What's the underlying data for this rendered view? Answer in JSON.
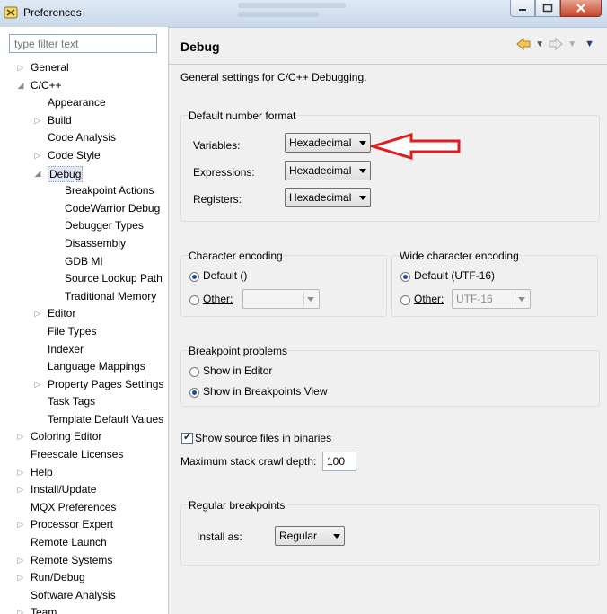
{
  "window": {
    "title": "Preferences"
  },
  "filter": {
    "placeholder": "type filter text"
  },
  "tree": [
    {
      "label": "General",
      "indent": 0,
      "arrow": "closed"
    },
    {
      "label": "C/C++",
      "indent": 0,
      "arrow": "open"
    },
    {
      "label": "Appearance",
      "indent": 1,
      "arrow": "none"
    },
    {
      "label": "Build",
      "indent": 1,
      "arrow": "closed"
    },
    {
      "label": "Code Analysis",
      "indent": 1,
      "arrow": "none"
    },
    {
      "label": "Code Style",
      "indent": 1,
      "arrow": "closed"
    },
    {
      "label": "Debug",
      "indent": 1,
      "arrow": "open",
      "selected": true
    },
    {
      "label": "Breakpoint Actions",
      "indent": 2,
      "arrow": "none"
    },
    {
      "label": "CodeWarrior Debug",
      "indent": 2,
      "arrow": "none"
    },
    {
      "label": "Debugger Types",
      "indent": 2,
      "arrow": "none"
    },
    {
      "label": "Disassembly",
      "indent": 2,
      "arrow": "none"
    },
    {
      "label": "GDB MI",
      "indent": 2,
      "arrow": "none"
    },
    {
      "label": "Source Lookup Path",
      "indent": 2,
      "arrow": "none"
    },
    {
      "label": "Traditional Memory",
      "indent": 2,
      "arrow": "none"
    },
    {
      "label": "Editor",
      "indent": 1,
      "arrow": "closed"
    },
    {
      "label": "File Types",
      "indent": 1,
      "arrow": "none"
    },
    {
      "label": "Indexer",
      "indent": 1,
      "arrow": "none"
    },
    {
      "label": "Language Mappings",
      "indent": 1,
      "arrow": "none"
    },
    {
      "label": "Property Pages Settings",
      "indent": 1,
      "arrow": "closed"
    },
    {
      "label": "Task Tags",
      "indent": 1,
      "arrow": "none"
    },
    {
      "label": "Template Default Values",
      "indent": 1,
      "arrow": "none"
    },
    {
      "label": "Coloring Editor",
      "indent": 0,
      "arrow": "closed"
    },
    {
      "label": "Freescale Licenses",
      "indent": 0,
      "arrow": "none"
    },
    {
      "label": "Help",
      "indent": 0,
      "arrow": "closed"
    },
    {
      "label": "Install/Update",
      "indent": 0,
      "arrow": "closed"
    },
    {
      "label": "MQX Preferences",
      "indent": 0,
      "arrow": "none"
    },
    {
      "label": "Processor Expert",
      "indent": 0,
      "arrow": "closed"
    },
    {
      "label": "Remote Launch",
      "indent": 0,
      "arrow": "none"
    },
    {
      "label": "Remote Systems",
      "indent": 0,
      "arrow": "closed"
    },
    {
      "label": "Run/Debug",
      "indent": 0,
      "arrow": "closed"
    },
    {
      "label": "Software Analysis",
      "indent": 0,
      "arrow": "none"
    },
    {
      "label": "Team",
      "indent": 0,
      "arrow": "closed"
    }
  ],
  "page": {
    "title": "Debug",
    "description": "General settings for C/C++ Debugging."
  },
  "number_format": {
    "legend": "Default number format",
    "variables_label": "Variables:",
    "variables_value": "Hexadecimal",
    "expressions_label": "Expressions:",
    "expressions_value": "Hexadecimal",
    "registers_label": "Registers:",
    "registers_value": "Hexadecimal"
  },
  "char_encoding": {
    "legend": "Character encoding",
    "default_label": "Default ()",
    "other_label": "Other:",
    "other_value": ""
  },
  "wide_encoding": {
    "legend": "Wide character encoding",
    "default_label": "Default (UTF-16)",
    "other_label": "Other:",
    "other_value": "UTF-16"
  },
  "breakpoint_problems": {
    "legend": "Breakpoint problems",
    "opt1": "Show in Editor",
    "opt2": "Show in Breakpoints View",
    "selected": "Show in Breakpoints View"
  },
  "show_source": {
    "label": "Show source files in binaries",
    "checked": true
  },
  "stack_depth": {
    "label": "Maximum stack crawl depth:",
    "value": "100"
  },
  "regular_breakpoints": {
    "legend": "Regular breakpoints",
    "install_label": "Install as:",
    "install_value": "Regular"
  },
  "colors": {
    "annotation_arrow": "#e01b1b",
    "selection": "#dfe9f6"
  }
}
